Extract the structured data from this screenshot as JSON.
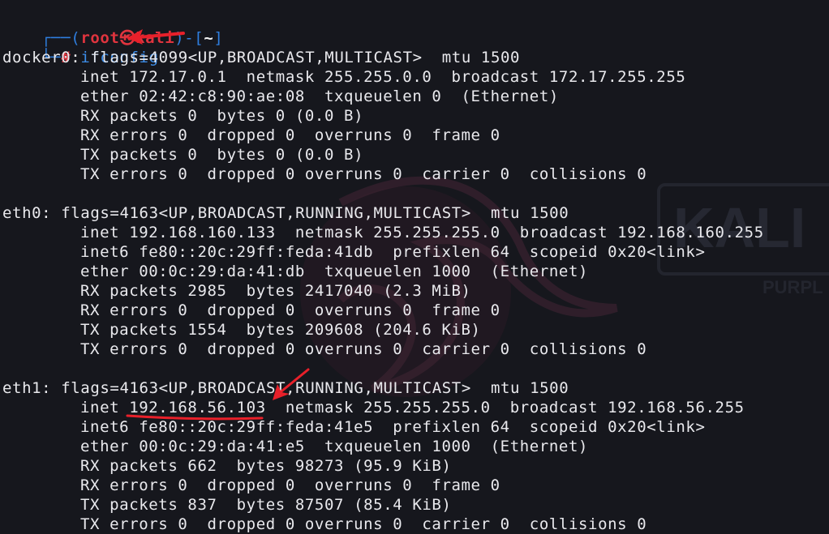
{
  "prompt": {
    "frame_top_left": "┌──(",
    "user": "root",
    "at_symbol": "㉿",
    "host": "kali",
    "frame_mid": ")-[",
    "path": "~",
    "frame_close": "]",
    "frame_bottom_left": "└─",
    "hash": "#",
    "command": "ifconfig"
  },
  "watermark": {
    "brand": "KALI",
    "sub": "PURPL"
  },
  "output": {
    "docker0": {
      "header": "docker0: flags=4099<UP,BROADCAST,MULTICAST>  mtu 1500",
      "lines": [
        "inet 172.17.0.1  netmask 255.255.0.0  broadcast 172.17.255.255",
        "ether 02:42:c8:90:ae:08  txqueuelen 0  (Ethernet)",
        "RX packets 0  bytes 0 (0.0 B)",
        "RX errors 0  dropped 0  overruns 0  frame 0",
        "TX packets 0  bytes 0 (0.0 B)",
        "TX errors 0  dropped 0 overruns 0  carrier 0  collisions 0"
      ]
    },
    "eth0": {
      "header": "eth0: flags=4163<UP,BROADCAST,RUNNING,MULTICAST>  mtu 1500",
      "lines": [
        "inet 192.168.160.133  netmask 255.255.255.0  broadcast 192.168.160.255",
        "inet6 fe80::20c:29ff:feda:41db  prefixlen 64  scopeid 0x20<link>",
        "ether 00:0c:29:da:41:db  txqueuelen 1000  (Ethernet)",
        "RX packets 2985  bytes 2417040 (2.3 MiB)",
        "RX errors 0  dropped 0  overruns 0  frame 0",
        "TX packets 1554  bytes 209608 (204.6 KiB)",
        "TX errors 0  dropped 0 overruns 0  carrier 0  collisions 0"
      ]
    },
    "eth1": {
      "header": "eth1: flags=4163<UP,BROADCAST,RUNNING,MULTICAST>  mtu 1500",
      "lines": [
        "inet 192.168.56.103  netmask 255.255.255.0  broadcast 192.168.56.255",
        "inet6 fe80::20c:29ff:feda:41e5  prefixlen 64  scopeid 0x20<link>",
        "ether 00:0c:29:da:41:e5  txqueuelen 1000  (Ethernet)",
        "RX packets 662  bytes 98273 (95.9 KiB)",
        "RX errors 0  dropped 0  overruns 0  frame 0",
        "TX packets 837  bytes 87507 (85.4 KiB)",
        "TX errors 0  dropped 0 overruns 0  carrier 0  collisions 0"
      ]
    }
  },
  "colors": {
    "background": "#16171d",
    "text": "#e9e9ed",
    "prompt_frame": "#2f7fe0",
    "prompt_user": "#e0343e",
    "command": "#3d8eea",
    "annotation": "#e8202a"
  },
  "annotations": [
    "arrow-to-command",
    "arrow-to-eth1-ip",
    "underline-eth1-ip"
  ]
}
